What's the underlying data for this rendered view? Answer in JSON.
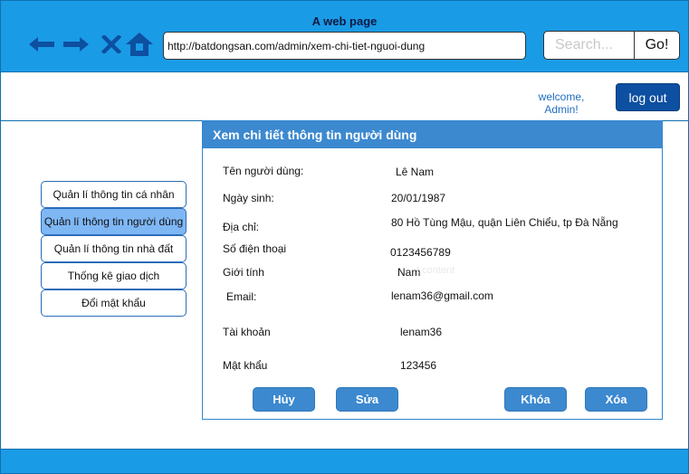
{
  "browser": {
    "page_title": "A web page",
    "url": "http://batdongsan.com/admin/xem-chi-tiet-nguoi-dung",
    "search_placeholder": "Search...",
    "go_label": "Go!",
    "icons": [
      "back-arrow-icon",
      "forward-arrow-icon",
      "close-icon",
      "home-icon"
    ]
  },
  "header": {
    "welcome_line1": "welcome,",
    "welcome_line2": "Admin!",
    "logout_label": "log out"
  },
  "sidebar": {
    "items": [
      {
        "label": "Quản lí thông tin cá nhân",
        "active": false
      },
      {
        "label": "Quản lí thông tin người dùng",
        "active": true
      },
      {
        "label": "Quản lí thông tin nhà đất",
        "active": false
      },
      {
        "label": "Thống kê giao dịch",
        "active": false
      },
      {
        "label": "Đổi mật khẩu",
        "active": false
      }
    ]
  },
  "detail": {
    "title": "Xem chi tiết thông tin người dùng",
    "fields": [
      {
        "label": "Tên người dùng:",
        "value": "Lê Nam"
      },
      {
        "label": "Ngày sinh:",
        "value": "20/01/1987"
      },
      {
        "label": "Địa chỉ:",
        "value": "80 Hồ Tùng Mậu, quận Liên Chiểu, tp Đà Nẵng"
      },
      {
        "label": "Số điện thoại",
        "value": "0123456789"
      },
      {
        "label": "Giới tính",
        "value": "Nam"
      },
      {
        "label": "Email:",
        "value": "lenam36@gmail.com"
      },
      {
        "label": "Tài khoản",
        "value": "lenam36"
      },
      {
        "label": "Mật khẩu",
        "value": "123456"
      }
    ],
    "ghost_text": "t content",
    "buttons": {
      "cancel": "Hủy",
      "edit": "Sửa",
      "lock": "Khóa",
      "delete": "Xóa"
    }
  },
  "colors": {
    "chrome": "#1a9be6",
    "panel_header": "#3c89d0",
    "logout": "#0d4fa0",
    "active_menu": "#7fb7f5",
    "nav_icons": "#0d4fa0"
  }
}
